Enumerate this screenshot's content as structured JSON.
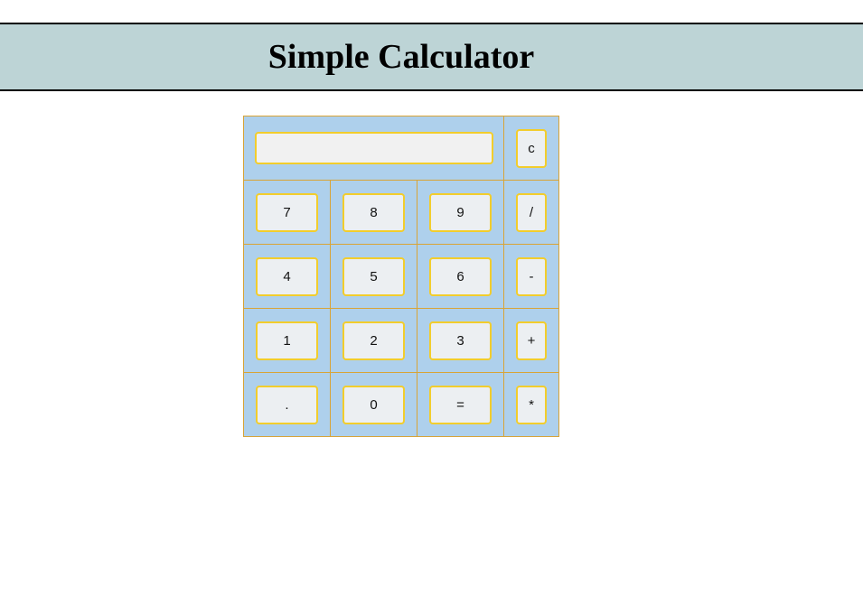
{
  "header": {
    "title": "Simple Calculator"
  },
  "display": {
    "value": "",
    "placeholder": ""
  },
  "keys": {
    "clear": "c",
    "divide": "/",
    "subtract": "-",
    "add": "+",
    "multiply": "*",
    "seven": "7",
    "eight": "8",
    "nine": "9",
    "four": "4",
    "five": "5",
    "six": "6",
    "one": "1",
    "two": "2",
    "three": "3",
    "decimal": ".",
    "zero": "0",
    "equals": "="
  },
  "colors": {
    "header_bg": "#bdd4d6",
    "keypad_bg": "#aed0ec",
    "cell_border": "#d8a437",
    "key_border": "#f2cd2c",
    "key_bg": "#eceff2"
  }
}
